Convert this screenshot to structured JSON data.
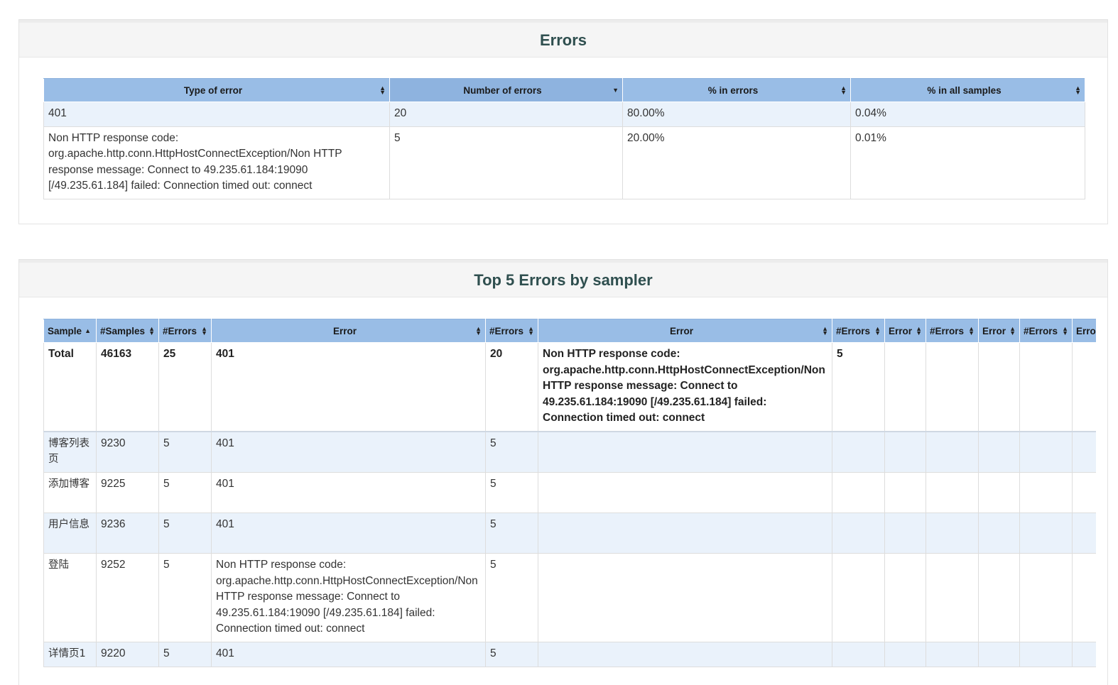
{
  "errors_panel": {
    "title": "Errors",
    "columns": [
      "Type of error",
      "Number of errors",
      "% in errors",
      "% in all samples"
    ],
    "rows": [
      {
        "type": "401",
        "count": "20",
        "pct_errors": "80.00%",
        "pct_samples": "0.04%"
      },
      {
        "type": "Non HTTP response code: org.apache.http.conn.HttpHostConnectException/Non HTTP response message: Connect to 49.235.61.184:19090 [/49.235.61.184] failed: Connection timed out: connect",
        "count": "5",
        "pct_errors": "20.00%",
        "pct_samples": "0.01%"
      }
    ]
  },
  "top5_panel": {
    "title": "Top 5 Errors by sampler",
    "columns": [
      "Sample",
      "#Samples",
      "#Errors",
      "Error",
      "#Errors",
      "Error",
      "#Errors",
      "Error",
      "#Errors",
      "Error",
      "#Errors",
      "Error"
    ],
    "total": {
      "sample": "Total",
      "samples": "46163",
      "errors": "25",
      "error1": "401",
      "errors1": "20",
      "error2": "Non HTTP response code: org.apache.http.conn.HttpHostConnectException/Non HTTP response message: Connect to 49.235.61.184:19090 [/49.235.61.184] failed: Connection timed out: connect",
      "errors2": "5"
    },
    "rows": [
      {
        "sample": "博客列表页",
        "samples": "9230",
        "errors": "5",
        "error1": "401",
        "errors1": "5"
      },
      {
        "sample": "添加博客",
        "samples": "9225",
        "errors": "5",
        "error1": "401",
        "errors1": "5"
      },
      {
        "sample": "用户信息",
        "samples": "9236",
        "errors": "5",
        "error1": "401",
        "errors1": "5"
      },
      {
        "sample": "登陆",
        "samples": "9252",
        "errors": "5",
        "error1": "Non HTTP response code: org.apache.http.conn.HttpHostConnectException/Non HTTP response message: Connect to 49.235.61.184:19090 [/49.235.61.184] failed: Connection timed out: connect",
        "errors1": "5"
      },
      {
        "sample": "详情页1",
        "samples": "9220",
        "errors": "5",
        "error1": "401",
        "errors1": "5"
      }
    ]
  },
  "colors": {
    "header_bg": "#99bde6",
    "odd_row_bg": "#eaf2fb",
    "title_color": "#2f4f4f"
  }
}
